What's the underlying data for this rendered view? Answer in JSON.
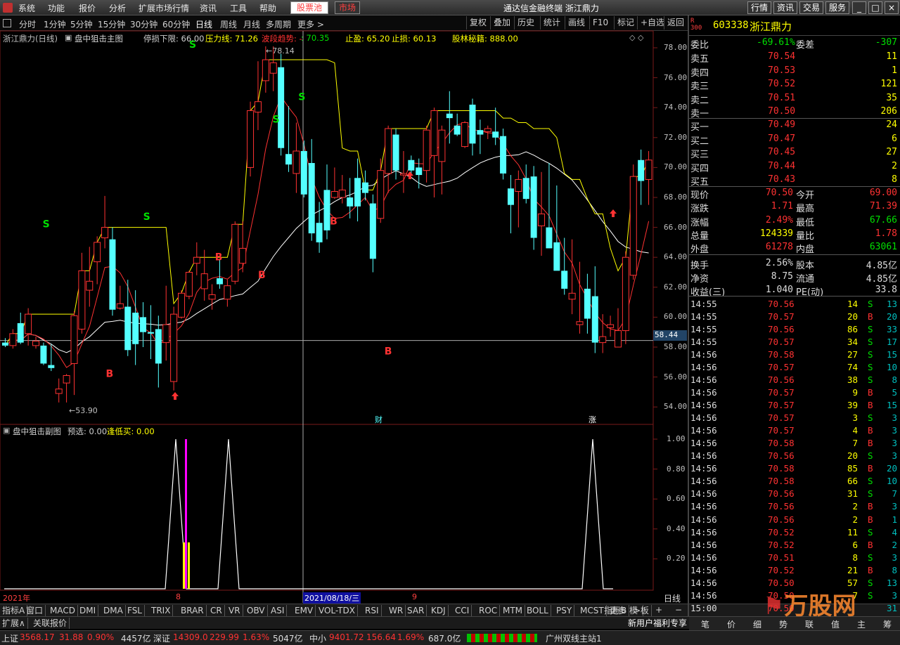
{
  "menu": {
    "items": [
      "系统",
      "功能",
      "报价",
      "分析",
      "扩展市场行情",
      "资讯",
      "工具",
      "帮助"
    ],
    "stockpool": "股票池",
    "market": "市场",
    "app_title": "通达信金融终端  浙江鼎力",
    "right_buttons": [
      "行情",
      "资讯",
      "交易",
      "服务"
    ]
  },
  "toolbar": {
    "periods": [
      "分时",
      "1分钟",
      "5分钟",
      "15分钟",
      "30分钟",
      "60分钟",
      "日线",
      "周线",
      "月线",
      "多周期",
      "更多 >"
    ],
    "active_period": "日线",
    "buttons": [
      "复权",
      "叠加",
      "历史",
      "统计",
      "画线",
      "F10",
      "标记",
      "+自选",
      "返回"
    ]
  },
  "info": {
    "stock": "浙江鼎力(日线)",
    "indicator": "盘中狙击主图",
    "stoploss_label": "停损下限: 66.00",
    "pressure_label": "压力线: 71.26",
    "wave_label": "波段趋势: -",
    "wave_value": ": 70.35",
    "takeprofit_label": "止盈: 65.20",
    "stopl_label": "止损: 60.13",
    "secret_label": "股林秘籍: 888.00"
  },
  "sub": {
    "indicator": "盘中狙击副图",
    "preselect": "预选: 0.00",
    "dipbuy": "逢低买: 0.00"
  },
  "yaxis_main": [
    "78.00",
    "76.00",
    "74.00",
    "72.00",
    "70.00",
    "68.00",
    "66.00",
    "64.00",
    "62.00",
    "60.00",
    "58.00",
    "56.00",
    "54.00"
  ],
  "yaxis_sub": [
    "1.00",
    "0.80",
    "0.60",
    "0.40",
    "0.20"
  ],
  "chart_data": [
    {
      "type": "candlestick",
      "title": "盘中狙击主图",
      "ylim": [
        53,
        79
      ],
      "current_price": 58.44,
      "high_mark": "78.14",
      "low_mark": "53.90",
      "annotations": [
        "S",
        "B",
        "财",
        "涨"
      ],
      "x_labels": [
        "2021年",
        "8",
        "2021/08/18/三",
        "9"
      ],
      "candles": [
        [
          58.3,
          58.6,
          58.0,
          58.1
        ],
        [
          58.1,
          59.2,
          57.9,
          58.9
        ],
        [
          59.6,
          60.3,
          58.2,
          58.3
        ],
        [
          58.9,
          60.6,
          58.1,
          60.2
        ],
        [
          58.1,
          58.7,
          57.9,
          58.4
        ],
        [
          58.1,
          58.3,
          56.8,
          56.9
        ],
        [
          56.8,
          58.2,
          56.4,
          56.6
        ],
        [
          54.9,
          55.9,
          54.3,
          55.2
        ],
        [
          55.6,
          56.2,
          54.3,
          56.1
        ],
        [
          56.9,
          60.4,
          54.8,
          60.1
        ],
        [
          59.2,
          64.3,
          58.9,
          63.1
        ],
        [
          61.8,
          64.7,
          60.7,
          62.4
        ],
        [
          63.7,
          65.4,
          62.2,
          65.0
        ],
        [
          65.3,
          68.1,
          64.6,
          66.0
        ],
        [
          65.2,
          66.0,
          60.1,
          60.5
        ],
        [
          60.6,
          62.1,
          60.5,
          60.9
        ],
        [
          60.7,
          62.5,
          57.4,
          57.8
        ],
        [
          60.3,
          61.8,
          56.8,
          58.2
        ],
        [
          60.0,
          61.0,
          58.0,
          59.0
        ],
        [
          59.0,
          60.8,
          57.2,
          58.9
        ],
        [
          59.2,
          60.1,
          55.3,
          56.9
        ],
        [
          58.3,
          62.1,
          57.1,
          59.5
        ],
        [
          55.7,
          60.7,
          55.1,
          60.2
        ],
        [
          60.0,
          61.8,
          59.9,
          61.6
        ],
        [
          61.4,
          63.1,
          61.2,
          63.0
        ],
        [
          63.6,
          65.0,
          62.8,
          64.0
        ],
        [
          61.9,
          64.5,
          61.1,
          62.9
        ],
        [
          61.2,
          62.2,
          60.5,
          61.5
        ],
        [
          62.6,
          63.9,
          61.9,
          62.2
        ],
        [
          61.2,
          62.5,
          60.7,
          62.1
        ],
        [
          62.4,
          66.4,
          62.2,
          66.2
        ],
        [
          63.6,
          66.4,
          63.0,
          64.6
        ],
        [
          70.0,
          74.4,
          69.4,
          73.8
        ],
        [
          73.7,
          77.1,
          72.5,
          74.4
        ],
        [
          75.8,
          78.1,
          75.0,
          77.2
        ],
        [
          76.3,
          78.1,
          75.1,
          77.0
        ],
        [
          76.7,
          77.6,
          70.8,
          71.3
        ],
        [
          70.9,
          74.1,
          69.7,
          70.2
        ],
        [
          69.6,
          73.0,
          68.3,
          71.1
        ],
        [
          71.1,
          71.8,
          68.0,
          68.2
        ],
        [
          70.3,
          71.9,
          65.1,
          65.6
        ],
        [
          66.3,
          67.7,
          64.3,
          65.0
        ],
        [
          68.5,
          70.2,
          65.2,
          65.8
        ],
        [
          68.0,
          70.0,
          67.9,
          68.4
        ],
        [
          68.0,
          69.5,
          67.6,
          68.5
        ],
        [
          68.0,
          69.3,
          66.6,
          67.4
        ],
        [
          69.3,
          70.6,
          66.4,
          67.4
        ],
        [
          69.0,
          69.8,
          67.8,
          68.3
        ],
        [
          67.6,
          68.2,
          63.0,
          63.9
        ],
        [
          66.6,
          70.6,
          66.3,
          69.8
        ],
        [
          69.6,
          72.8,
          68.3,
          72.6
        ],
        [
          72.2,
          72.6,
          69.2,
          69.8
        ],
        [
          69.5,
          71.1,
          68.3,
          69.6
        ],
        [
          70.5,
          70.8,
          69.6,
          69.8
        ],
        [
          70.0,
          70.6,
          68.6,
          69.5
        ],
        [
          69.8,
          72.8,
          69.0,
          72.5
        ],
        [
          70.8,
          74.0,
          68.0,
          73.8
        ],
        [
          70.4,
          72.8,
          68.2,
          72.5
        ],
        [
          73.6,
          75.1,
          71.6,
          73.3
        ],
        [
          72.8,
          73.6,
          72.1,
          72.2
        ],
        [
          71.4,
          73.1,
          71.3,
          73.0
        ],
        [
          74.2,
          74.6,
          70.8,
          71.6
        ],
        [
          72.5,
          73.2,
          70.9,
          72.2
        ],
        [
          72.4,
          72.8,
          71.9,
          72.6
        ],
        [
          72.4,
          74.0,
          71.5,
          72.0
        ],
        [
          72.1,
          72.6,
          69.2,
          69.6
        ],
        [
          68.6,
          69.5,
          65.6,
          67.5
        ],
        [
          68.4,
          69.8,
          66.0,
          69.2
        ],
        [
          69.3,
          70.2,
          67.6,
          67.9
        ],
        [
          69.4,
          70.1,
          64.5,
          65.3
        ],
        [
          66.1,
          69.7,
          64.1,
          66.9
        ],
        [
          66.0,
          70.3,
          64.8,
          64.6
        ],
        [
          65.0,
          68.8,
          64.3,
          63.1
        ],
        [
          63.1,
          65.3,
          61.5,
          61.9
        ],
        [
          61.2,
          65.2,
          60.2,
          61.6
        ],
        [
          59.5,
          63.7,
          58.9,
          59.7
        ],
        [
          61.9,
          62.9,
          58.9,
          59.9
        ],
        [
          61.4,
          63.4,
          57.6,
          58.3
        ],
        [
          58.3,
          60.2,
          57.6,
          58.7
        ],
        [
          59.3,
          60.1,
          58.7,
          59.5
        ],
        [
          58.0,
          60.6,
          58.2,
          59.1
        ],
        [
          59.1,
          64.4,
          58.2,
          64.0
        ],
        [
          62.8,
          70.2,
          62.5,
          69.4
        ],
        [
          70.5,
          71.2,
          67.5,
          69.1
        ],
        [
          69.2,
          71.1,
          67.5,
          70.5
        ]
      ]
    },
    {
      "type": "line",
      "title": "盘中狙击副图",
      "ylim": [
        0,
        1
      ],
      "series": [
        {
          "name": "预选",
          "values": [
            0,
            1,
            0,
            1,
            0,
            1,
            0
          ]
        }
      ]
    }
  ],
  "orderbook": {
    "code": "603338",
    "name": "浙江鼎力",
    "weibi_label": "委比",
    "weibi": "-69.61%",
    "weicha_label": "委差",
    "weicha": "-307",
    "asks": [
      {
        "label": "卖五",
        "price": "70.54",
        "vol": "11"
      },
      {
        "label": "卖四",
        "price": "70.53",
        "vol": "1"
      },
      {
        "label": "卖三",
        "price": "70.52",
        "vol": "121"
      },
      {
        "label": "卖二",
        "price": "70.51",
        "vol": "35"
      },
      {
        "label": "卖一",
        "price": "70.50",
        "vol": "206"
      }
    ],
    "bids": [
      {
        "label": "买一",
        "price": "70.49",
        "vol": "24"
      },
      {
        "label": "买二",
        "price": "70.47",
        "vol": "6"
      },
      {
        "label": "买三",
        "price": "70.45",
        "vol": "27"
      },
      {
        "label": "买四",
        "price": "70.44",
        "vol": "2"
      },
      {
        "label": "买五",
        "price": "70.43",
        "vol": "8"
      }
    ]
  },
  "quote": [
    {
      "l": "现价",
      "v": "70.50",
      "l2": "今开",
      "v2": "69.00"
    },
    {
      "l": "涨跌",
      "v": "1.71",
      "l2": "最高",
      "v2": "71.39"
    },
    {
      "l": "涨幅",
      "v": "2.49%",
      "l2": "最低",
      "v2": "67.66"
    },
    {
      "l": "总量",
      "v": "124339",
      "l2": "量比",
      "v2": "1.78"
    },
    {
      "l": "外盘",
      "v": "61278",
      "l2": "内盘",
      "v2": "63061"
    },
    {
      "l": "换手",
      "v": "2.56%",
      "l2": "股本",
      "v2": "4.85亿"
    },
    {
      "l": "净资",
      "v": "8.75",
      "l2": "流通",
      "v2": "4.85亿"
    },
    {
      "l": "收益(三)",
      "v": "1.040",
      "l2": "PE(动)",
      "v2": "33.8"
    }
  ],
  "ticks": [
    [
      "14:55",
      "70.56",
      "14",
      "S",
      "13"
    ],
    [
      "14:55",
      "70.57",
      "20",
      "B",
      "20"
    ],
    [
      "14:55",
      "70.56",
      "86",
      "S",
      "33"
    ],
    [
      "14:55",
      "70.57",
      "34",
      "S",
      "17"
    ],
    [
      "14:56",
      "70.58",
      "27",
      "S",
      "15"
    ],
    [
      "14:56",
      "70.57",
      "74",
      "S",
      "10"
    ],
    [
      "14:56",
      "70.56",
      "38",
      "S",
      "8"
    ],
    [
      "14:56",
      "70.57",
      "9",
      "B",
      "5"
    ],
    [
      "14:56",
      "70.57",
      "39",
      "B",
      "15"
    ],
    [
      "14:56",
      "70.57",
      "3",
      "S",
      "3"
    ],
    [
      "14:56",
      "70.57",
      "4",
      "B",
      "3"
    ],
    [
      "14:56",
      "70.58",
      "7",
      "B",
      "3"
    ],
    [
      "14:56",
      "70.56",
      "20",
      "S",
      "3"
    ],
    [
      "14:56",
      "70.58",
      "85",
      "B",
      "20"
    ],
    [
      "14:56",
      "70.58",
      "66",
      "S",
      "10"
    ],
    [
      "14:56",
      "70.56",
      "31",
      "S",
      "7"
    ],
    [
      "14:56",
      "70.56",
      "2",
      "B",
      "3"
    ],
    [
      "14:56",
      "70.56",
      "2",
      "B",
      "1"
    ],
    [
      "14:56",
      "70.52",
      "11",
      "S",
      "4"
    ],
    [
      "14:56",
      "70.52",
      "6",
      "B",
      "2"
    ],
    [
      "14:56",
      "70.51",
      "8",
      "S",
      "3"
    ],
    [
      "14:56",
      "70.52",
      "21",
      "B",
      "8"
    ],
    [
      "14:56",
      "70.50",
      "57",
      "S",
      "13"
    ],
    [
      "14:56",
      "70.50",
      "7",
      "S",
      "3"
    ],
    [
      "15:00",
      "70.50",
      "",
      "",
      "31"
    ]
  ],
  "indicator_tabs": [
    "指标A",
    "窗口",
    "MACD",
    "DMI",
    "DMA",
    "FSL",
    "TRIX",
    "BRAR",
    "CR",
    "VR",
    "OBV",
    "ASI",
    "EMV",
    "VOL-TDX",
    "RSI",
    "WR",
    "SAR",
    "KDJ",
    "CCI",
    "ROC",
    "MTM",
    "BOLL",
    "PSY",
    "MCST",
    "更多",
    ">"
  ],
  "right_tabs": [
    "指标B",
    "模 板"
  ],
  "period_label": "日线",
  "ext_tabs": [
    "扩展∧",
    "关联报价"
  ],
  "welfare": "新用户福利专享",
  "right_bottom_tabs": [
    "笔",
    "价",
    "细",
    "势",
    "联",
    "值",
    "主",
    "筹"
  ],
  "status": {
    "sh_label": "上证",
    "sh_index": "3568.17",
    "sh_chg": "31.88",
    "sh_pct": "0.90%",
    "sh_amt": "4457亿",
    "sz_label": "深证",
    "sz_index": "14309.0",
    "sz_chg": "229.99",
    "sz_pct": "1.63%",
    "sz_amt": "5047亿",
    "zx_label": "中小",
    "zx_index": "9401.72",
    "zx_chg": "156.64",
    "zx_pct": "1.69%",
    "zx_amt": "687.0亿",
    "station": "广州双线主站1"
  },
  "watermark": "万股网",
  "colors": {
    "up": "#ff3232",
    "down": "#54ffff",
    "yellow": "#ffff00",
    "green": "#00e000"
  }
}
